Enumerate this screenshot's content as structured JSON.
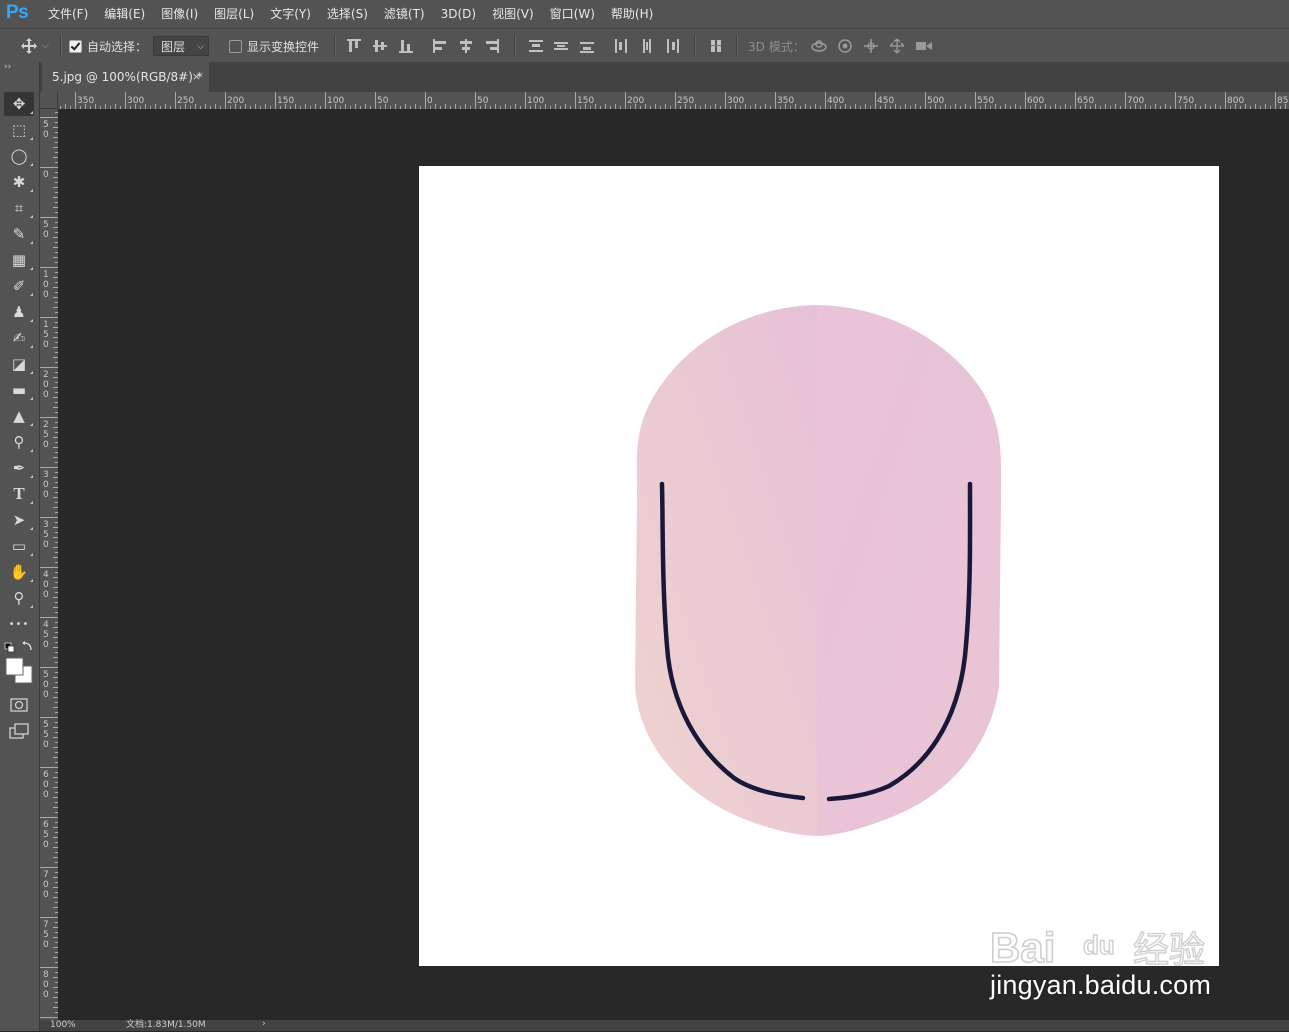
{
  "app": {
    "logo": "Ps",
    "brand_color": "#31a8ff"
  },
  "menu": [
    "文件(F)",
    "编辑(E)",
    "图像(I)",
    "图层(L)",
    "文字(Y)",
    "选择(S)",
    "滤镜(T)",
    "3D(D)",
    "视图(V)",
    "窗口(W)",
    "帮助(H)"
  ],
  "options": {
    "auto_select_label": "自动选择：",
    "auto_select_checked": true,
    "layer_select_value": "图层",
    "show_transform_label": "显示变换控件",
    "show_transform_checked": false,
    "mode_3d_label": "3D 模式："
  },
  "document": {
    "tab_title": "5.jpg @ 100%(RGB/8#) *",
    "close_glyph": "×",
    "canvas_background": "#ffffff",
    "image_colors": {
      "shape_light": "#efd3cf",
      "shape_mid": "#e6c1d6",
      "stroke": "#1a1838"
    }
  },
  "rulers": {
    "horizontal_labels": [
      "350",
      "300",
      "250",
      "200",
      "150",
      "100",
      "50",
      "0",
      "50",
      "100",
      "150",
      "200",
      "250",
      "300",
      "350",
      "400",
      "450",
      "500",
      "550",
      "600",
      "650",
      "700",
      "750",
      "800",
      "850"
    ],
    "vertical_labels": [
      "50",
      "0",
      "50",
      "100",
      "150",
      "200",
      "250",
      "300",
      "350",
      "400",
      "450",
      "500",
      "550",
      "600",
      "650",
      "700",
      "750",
      "800"
    ]
  },
  "tools": [
    {
      "name": "move-tool",
      "glyph": "✥",
      "active": true
    },
    {
      "name": "marquee-tool",
      "glyph": "⬚"
    },
    {
      "name": "lasso-tool",
      "glyph": "◯"
    },
    {
      "name": "magic-wand-tool",
      "glyph": "✱"
    },
    {
      "name": "crop-tool",
      "glyph": "⌗"
    },
    {
      "name": "eyedropper-tool",
      "glyph": "✎"
    },
    {
      "name": "healing-tool",
      "glyph": "▦"
    },
    {
      "name": "brush-tool",
      "glyph": "✐"
    },
    {
      "name": "stamp-tool",
      "glyph": "♟"
    },
    {
      "name": "history-brush-tool",
      "glyph": "✍"
    },
    {
      "name": "eraser-tool",
      "glyph": "◪"
    },
    {
      "name": "gradient-tool",
      "glyph": "▬"
    },
    {
      "name": "blur-tool",
      "glyph": "▲"
    },
    {
      "name": "dodge-tool",
      "glyph": "⚲"
    },
    {
      "name": "pen-tool",
      "glyph": "✒"
    },
    {
      "name": "type-tool",
      "glyph": "T"
    },
    {
      "name": "path-select-tool",
      "glyph": "➤"
    },
    {
      "name": "rectangle-tool",
      "glyph": "▭"
    },
    {
      "name": "hand-tool",
      "glyph": "✋"
    },
    {
      "name": "zoom-tool",
      "glyph": "⚲"
    },
    {
      "name": "more-tools",
      "glyph": "•••"
    }
  ],
  "colors": {
    "foreground": "#ffffff",
    "background": "#ffffff"
  },
  "status": {
    "zoom": "100%",
    "doc_info": "文档:1.83M/1.50M"
  },
  "watermark": {
    "url": "jingyan.baidu.com",
    "logo_text": "Bai du 经验"
  }
}
